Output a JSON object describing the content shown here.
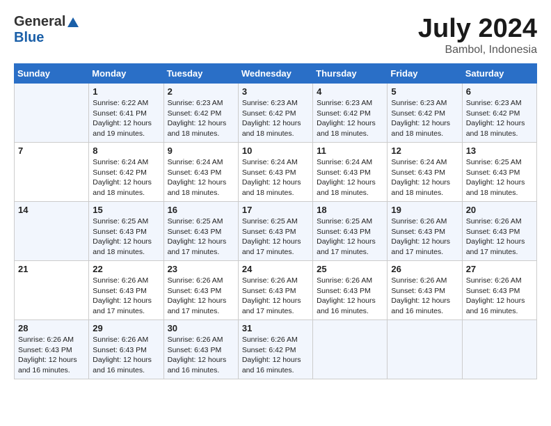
{
  "header": {
    "logo_general": "General",
    "logo_blue": "Blue",
    "title": "July 2024",
    "location": "Bambol, Indonesia"
  },
  "calendar": {
    "days_of_week": [
      "Sunday",
      "Monday",
      "Tuesday",
      "Wednesday",
      "Thursday",
      "Friday",
      "Saturday"
    ],
    "weeks": [
      [
        {
          "day": "",
          "info": ""
        },
        {
          "day": "1",
          "info": "Sunrise: 6:22 AM\nSunset: 6:41 PM\nDaylight: 12 hours\nand 19 minutes."
        },
        {
          "day": "2",
          "info": "Sunrise: 6:23 AM\nSunset: 6:42 PM\nDaylight: 12 hours\nand 18 minutes."
        },
        {
          "day": "3",
          "info": "Sunrise: 6:23 AM\nSunset: 6:42 PM\nDaylight: 12 hours\nand 18 minutes."
        },
        {
          "day": "4",
          "info": "Sunrise: 6:23 AM\nSunset: 6:42 PM\nDaylight: 12 hours\nand 18 minutes."
        },
        {
          "day": "5",
          "info": "Sunrise: 6:23 AM\nSunset: 6:42 PM\nDaylight: 12 hours\nand 18 minutes."
        },
        {
          "day": "6",
          "info": "Sunrise: 6:23 AM\nSunset: 6:42 PM\nDaylight: 12 hours\nand 18 minutes."
        }
      ],
      [
        {
          "day": "7",
          "info": ""
        },
        {
          "day": "8",
          "info": "Sunrise: 6:24 AM\nSunset: 6:42 PM\nDaylight: 12 hours\nand 18 minutes."
        },
        {
          "day": "9",
          "info": "Sunrise: 6:24 AM\nSunset: 6:43 PM\nDaylight: 12 hours\nand 18 minutes."
        },
        {
          "day": "10",
          "info": "Sunrise: 6:24 AM\nSunset: 6:43 PM\nDaylight: 12 hours\nand 18 minutes."
        },
        {
          "day": "11",
          "info": "Sunrise: 6:24 AM\nSunset: 6:43 PM\nDaylight: 12 hours\nand 18 minutes."
        },
        {
          "day": "12",
          "info": "Sunrise: 6:24 AM\nSunset: 6:43 PM\nDaylight: 12 hours\nand 18 minutes."
        },
        {
          "day": "13",
          "info": "Sunrise: 6:25 AM\nSunset: 6:43 PM\nDaylight: 12 hours\nand 18 minutes."
        }
      ],
      [
        {
          "day": "14",
          "info": ""
        },
        {
          "day": "15",
          "info": "Sunrise: 6:25 AM\nSunset: 6:43 PM\nDaylight: 12 hours\nand 18 minutes."
        },
        {
          "day": "16",
          "info": "Sunrise: 6:25 AM\nSunset: 6:43 PM\nDaylight: 12 hours\nand 17 minutes."
        },
        {
          "day": "17",
          "info": "Sunrise: 6:25 AM\nSunset: 6:43 PM\nDaylight: 12 hours\nand 17 minutes."
        },
        {
          "day": "18",
          "info": "Sunrise: 6:25 AM\nSunset: 6:43 PM\nDaylight: 12 hours\nand 17 minutes."
        },
        {
          "day": "19",
          "info": "Sunrise: 6:26 AM\nSunset: 6:43 PM\nDaylight: 12 hours\nand 17 minutes."
        },
        {
          "day": "20",
          "info": "Sunrise: 6:26 AM\nSunset: 6:43 PM\nDaylight: 12 hours\nand 17 minutes."
        }
      ],
      [
        {
          "day": "21",
          "info": ""
        },
        {
          "day": "22",
          "info": "Sunrise: 6:26 AM\nSunset: 6:43 PM\nDaylight: 12 hours\nand 17 minutes."
        },
        {
          "day": "23",
          "info": "Sunrise: 6:26 AM\nSunset: 6:43 PM\nDaylight: 12 hours\nand 17 minutes."
        },
        {
          "day": "24",
          "info": "Sunrise: 6:26 AM\nSunset: 6:43 PM\nDaylight: 12 hours\nand 17 minutes."
        },
        {
          "day": "25",
          "info": "Sunrise: 6:26 AM\nSunset: 6:43 PM\nDaylight: 12 hours\nand 16 minutes."
        },
        {
          "day": "26",
          "info": "Sunrise: 6:26 AM\nSunset: 6:43 PM\nDaylight: 12 hours\nand 16 minutes."
        },
        {
          "day": "27",
          "info": "Sunrise: 6:26 AM\nSunset: 6:43 PM\nDaylight: 12 hours\nand 16 minutes."
        }
      ],
      [
        {
          "day": "28",
          "info": "Sunrise: 6:26 AM\nSunset: 6:43 PM\nDaylight: 12 hours\nand 16 minutes."
        },
        {
          "day": "29",
          "info": "Sunrise: 6:26 AM\nSunset: 6:43 PM\nDaylight: 12 hours\nand 16 minutes."
        },
        {
          "day": "30",
          "info": "Sunrise: 6:26 AM\nSunset: 6:43 PM\nDaylight: 12 hours\nand 16 minutes."
        },
        {
          "day": "31",
          "info": "Sunrise: 6:26 AM\nSunset: 6:42 PM\nDaylight: 12 hours\nand 16 minutes."
        },
        {
          "day": "",
          "info": ""
        },
        {
          "day": "",
          "info": ""
        },
        {
          "day": "",
          "info": ""
        }
      ]
    ]
  }
}
